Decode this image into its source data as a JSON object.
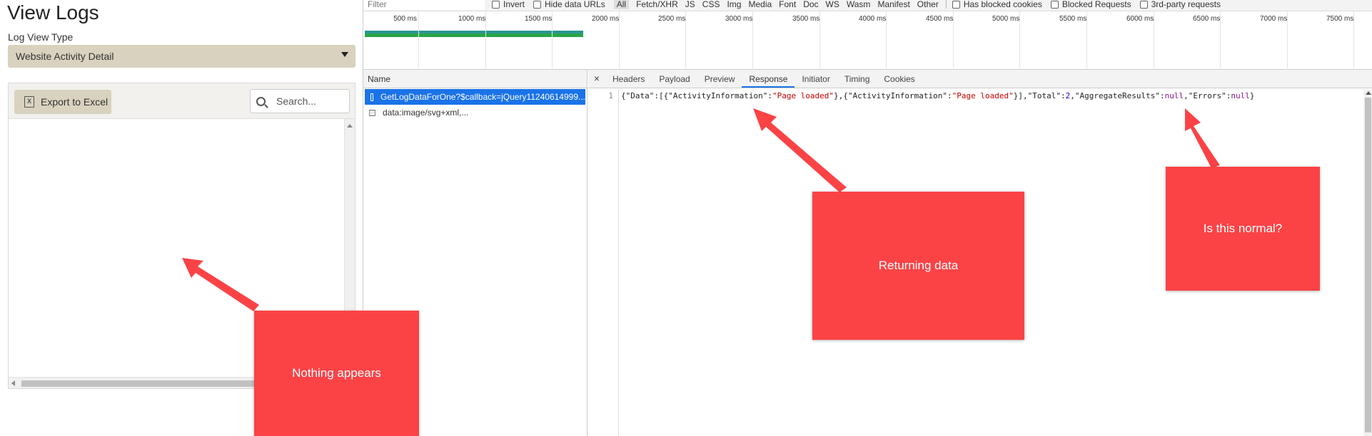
{
  "app": {
    "title": "View Logs",
    "log_view_label": "Log View Type",
    "log_view_value": "Website Activity Detail",
    "export_label": "Export to Excel",
    "excel_icon_glyph": "X",
    "search_placeholder": "Search..."
  },
  "devtools": {
    "filter_placeholder": "Filter",
    "checkboxes": {
      "invert": "Invert",
      "hide_data_urls": "Hide data URLs"
    },
    "types": [
      "All",
      "Fetch/XHR",
      "JS",
      "CSS",
      "Img",
      "Media",
      "Font",
      "Doc",
      "WS",
      "Wasm",
      "Manifest",
      "Other"
    ],
    "active_type": "All",
    "extra_checkboxes": [
      "Has blocked cookies",
      "Blocked Requests",
      "3rd-party requests"
    ],
    "timeline_ticks": [
      "500 ms",
      "1000 ms",
      "1500 ms",
      "2000 ms",
      "2500 ms",
      "3000 ms",
      "3500 ms",
      "4000 ms",
      "4500 ms",
      "5000 ms",
      "5500 ms",
      "6000 ms",
      "6500 ms",
      "7000 ms",
      "7500 ms"
    ],
    "names_header": "Name",
    "requests": [
      {
        "name": "GetLogDataForOne?$callback=jQuery11240614999...",
        "selected": true,
        "icon": "document-icon"
      },
      {
        "name": "data:image/svg+xml,...",
        "selected": false,
        "icon": "image-icon"
      }
    ],
    "close_glyph": "×",
    "tabs": [
      "Headers",
      "Payload",
      "Preview",
      "Response",
      "Initiator",
      "Timing",
      "Cookies"
    ],
    "active_tab": "Response",
    "line_number": "1",
    "response_line": "{\"Data\":[{\"ActivityInformation\":\"Page loaded\"},{\"ActivityInformation\":\"Page loaded\"}],\"Total\":2,\"AggregateResults\":null,\"Errors\":null}"
  },
  "annotations": {
    "nothing_appears": "Nothing appears",
    "returning_data": "Returning data",
    "is_this_normal": "Is this normal?",
    "color": "#fb4346"
  }
}
